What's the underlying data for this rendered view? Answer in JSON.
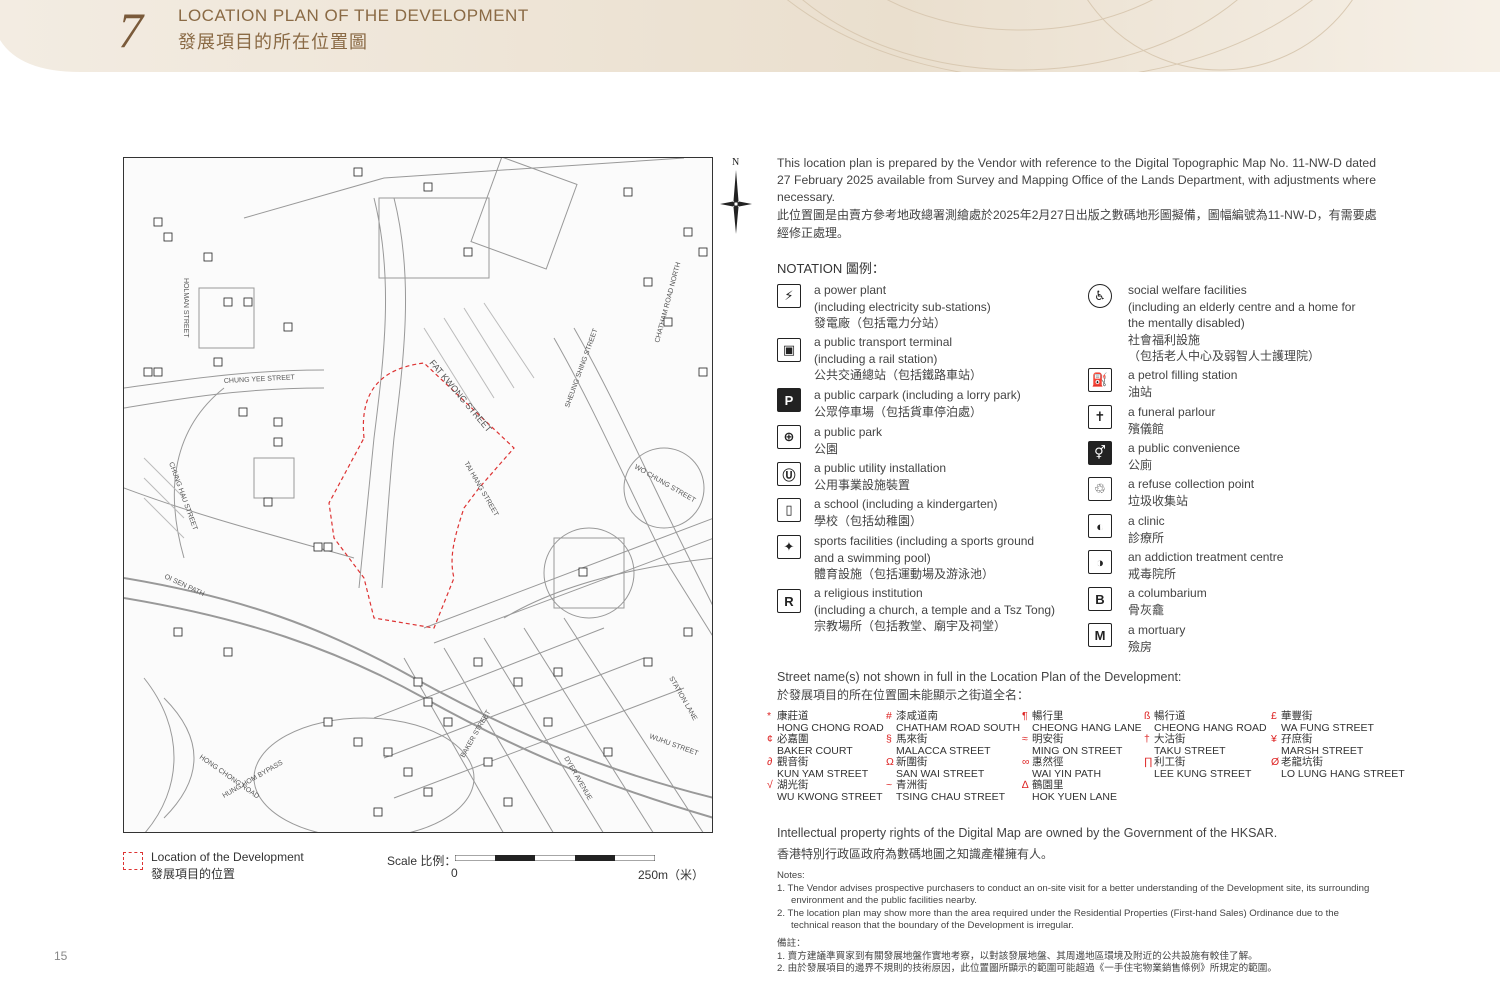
{
  "header": {
    "section_number": "7",
    "title_en": "LOCATION PLAN OF THE DEVELOPMENT",
    "title_zh": "發展項目的所在位置圖"
  },
  "colors": {
    "accent": "#8a6a45",
    "banner": "#efe6da",
    "boundary": "#d33"
  },
  "compass": {
    "north_label": "N"
  },
  "map": {
    "street_labels": [
      "FAT KWONG STREET",
      "HOLMAN STREET",
      "CHUNG YEE STREET",
      "CHUNG HAU STREET",
      "TAI HANG STREET",
      "CHATHAM ROAD NORTH",
      "SHEUNG SHING STREET",
      "WO CHUNG STREET",
      "OI SEN PATH",
      "HUNG HOM BYPASS",
      "HONG CHONG ROAD",
      "BAKER STREET",
      "WUHU STREET",
      "STATION LANE",
      "DYER AVENUE"
    ]
  },
  "map_legend": {
    "label_en": "Location of the Development",
    "label_zh": "發展項目的位置"
  },
  "scale": {
    "label": "Scale 比例：",
    "start": "0",
    "end": "250m（米）"
  },
  "intro": {
    "en": "This location plan is prepared by the Vendor with reference to the Digital Topographic Map No. 11-NW-D dated 27 February 2025 available from Survey and Mapping Office of the Lands Department, with adjustments where necessary.",
    "zh": "此位置圖是由賣方參考地政總署測繪處於2025年2月27日出版之數碼地形圖擬備，圖幅編號為11-NW-D，有需要處經修正處理。"
  },
  "notation": {
    "title": "NOTATION 圖例：",
    "left": [
      {
        "icon": "power-plant-icon",
        "lines": [
          "a power plant",
          "(including electricity sub-stations)",
          "發電廠（包括電力分站）"
        ]
      },
      {
        "icon": "bus-icon",
        "lines": [
          "a public transport terminal",
          "(including a rail station)",
          "公共交通總站（包括鐵路車站）"
        ]
      },
      {
        "icon": "parking-icon",
        "lines": [
          "a public carpark (including a lorry park)",
          "公眾停車場（包括貨車停泊處）"
        ]
      },
      {
        "icon": "park-icon",
        "lines": [
          "a public park",
          "公園"
        ]
      },
      {
        "icon": "utility-icon",
        "lines": [
          "a public utility installation",
          "公用事業設施裝置"
        ]
      },
      {
        "icon": "school-icon",
        "lines": [
          "a school (including a kindergarten)",
          "學校（包括幼稚園）"
        ]
      },
      {
        "icon": "sports-icon",
        "lines": [
          "sports facilities (including a sports ground",
          "and a swimming pool)",
          "體育設施（包括運動場及游泳池）"
        ]
      },
      {
        "icon": "religious-icon",
        "lines": [
          "a religious institution",
          "(including a church, a temple and a Tsz Tong)",
          "宗教場所（包括教堂、廟宇及祠堂）"
        ]
      }
    ],
    "right": [
      {
        "icon": "social-welfare-icon",
        "lines": [
          "social welfare facilities",
          "(including an elderly centre and a home for",
          "the mentally disabled)",
          "社會福利設施",
          "（包括老人中心及弱智人士護理院）"
        ]
      },
      {
        "icon": "petrol-icon",
        "lines": [
          "a petrol filling station",
          "油站"
        ]
      },
      {
        "icon": "funeral-icon",
        "lines": [
          "a funeral parlour",
          "殯儀館"
        ]
      },
      {
        "icon": "toilet-icon",
        "lines": [
          "a public convenience",
          "公廁"
        ]
      },
      {
        "icon": "refuse-icon",
        "lines": [
          "a refuse collection point",
          "垃圾收集站"
        ]
      },
      {
        "icon": "clinic-icon",
        "lines": [
          "a clinic",
          "診療所"
        ]
      },
      {
        "icon": "addiction-icon",
        "lines": [
          "an addiction treatment centre",
          "戒毒院所"
        ]
      },
      {
        "icon": "columbarium-icon",
        "lines": [
          "a columbarium",
          "骨灰龕"
        ]
      },
      {
        "icon": "mortuary-icon",
        "lines": [
          "a mortuary",
          "殮房"
        ]
      }
    ]
  },
  "streets": {
    "title_en": "Street name(s) not shown in full in the Location Plan of the Development:",
    "title_zh": "於發展項目的所在位置圖未能顯示之街道全名：",
    "items": [
      {
        "sym": "*",
        "zh": "康莊道",
        "en": "HONG CHONG ROAD"
      },
      {
        "sym": "#",
        "zh": "漆咸道南",
        "en": "CHATHAM ROAD SOUTH"
      },
      {
        "sym": "¶",
        "zh": "暢行里",
        "en": "CHEONG HANG LANE"
      },
      {
        "sym": "ß",
        "zh": "暢行道",
        "en": "CHEONG HANG ROAD"
      },
      {
        "sym": "£",
        "zh": "華豐街",
        "en": "WA FUNG STREET"
      },
      {
        "sym": "¢",
        "zh": "必嘉圍",
        "en": "BAKER COURT"
      },
      {
        "sym": "§",
        "zh": "馬來街",
        "en": "MALACCA STREET"
      },
      {
        "sym": "≈",
        "zh": "明安街",
        "en": "MING ON STREET"
      },
      {
        "sym": "†",
        "zh": "大沽街",
        "en": "TAKU STREET"
      },
      {
        "sym": "¥",
        "zh": "孖庶街",
        "en": "MARSH STREET"
      },
      {
        "sym": "∂",
        "zh": "觀音街",
        "en": "KUN YAM STREET"
      },
      {
        "sym": "Ω",
        "zh": "新圍街",
        "en": "SAN WAI STREET"
      },
      {
        "sym": "∞",
        "zh": "惠然徑",
        "en": "WAI YIN PATH"
      },
      {
        "sym": "∏",
        "zh": "利工街",
        "en": "LEE KUNG STREET"
      },
      {
        "sym": "Ø",
        "zh": "老龍坑街",
        "en": "LO LUNG HANG STREET"
      },
      {
        "sym": "√",
        "zh": "湖光街",
        "en": "WU KWONG STREET"
      },
      {
        "sym": "~",
        "zh": "青洲街",
        "en": "TSING CHAU STREET"
      },
      {
        "sym": "∆",
        "zh": "鶴園里",
        "en": "HOK YUEN LANE"
      }
    ]
  },
  "ipr": {
    "en": "Intellectual property rights of the Digital Map are owned by the Government of the HKSAR.",
    "zh": "香港特別行政區政府為數碼地圖之知識產權擁有人。"
  },
  "notes": {
    "title_en": "Notes:",
    "en": [
      "1.  The Vendor advises prospective purchasers to conduct an on-site visit for a better understanding of the Development site, its surrounding environment and the public facilities nearby.",
      "2.  The location plan may show more than the area required under the Residential Properties (First-hand Sales) Ordinance due to the technical reason that the boundary of the Development is irregular."
    ],
    "title_zh": "備註：",
    "zh": [
      "1.  賣方建議準買家到有關發展地盤作實地考察，以對該發展地盤、其周邊地區環境及附近的公共設施有較佳了解。",
      "2.  由於發展項目的邊界不規則的技術原因，此位置圖所顯示的範圍可能超過《一手住宅物業銷售條例》所規定的範圍。"
    ]
  },
  "page_number": "15"
}
